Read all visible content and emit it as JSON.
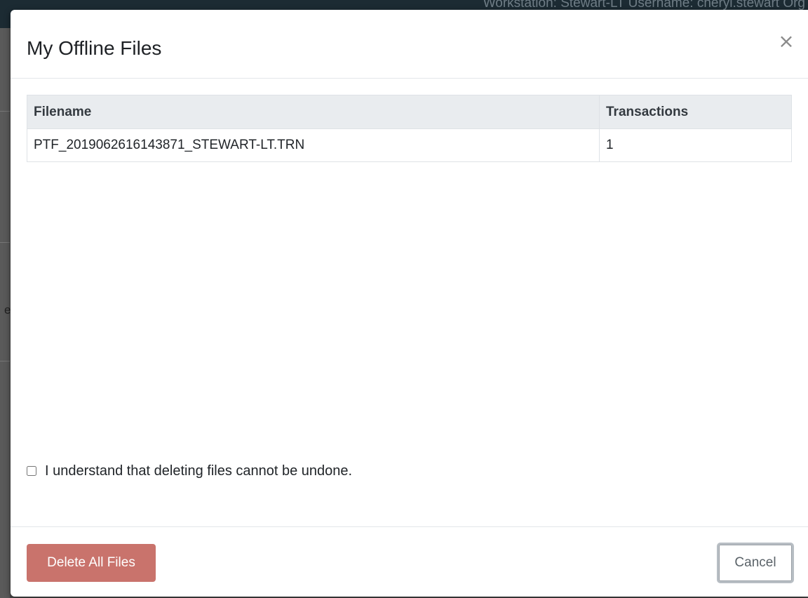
{
  "background": {
    "status_text": "Workstation: Stewart-LT  Username: cheryl.stewart  Org",
    "left_char": "e"
  },
  "modal": {
    "title": "My Offline Files",
    "close_glyph": "×",
    "close_icon": "close-icon"
  },
  "table": {
    "headers": [
      "Filename",
      "Transactions"
    ],
    "rows": [
      [
        "PTF_2019062616143871_STEWART-LT.TRN",
        "1"
      ]
    ]
  },
  "confirm": {
    "label": "I understand that deleting files cannot be undone.",
    "checked": false
  },
  "footer": {
    "delete_label": "Delete All Files",
    "cancel_label": "Cancel"
  },
  "colors": {
    "delete_button": "#c9736c",
    "header_row": "#e9ecef"
  }
}
